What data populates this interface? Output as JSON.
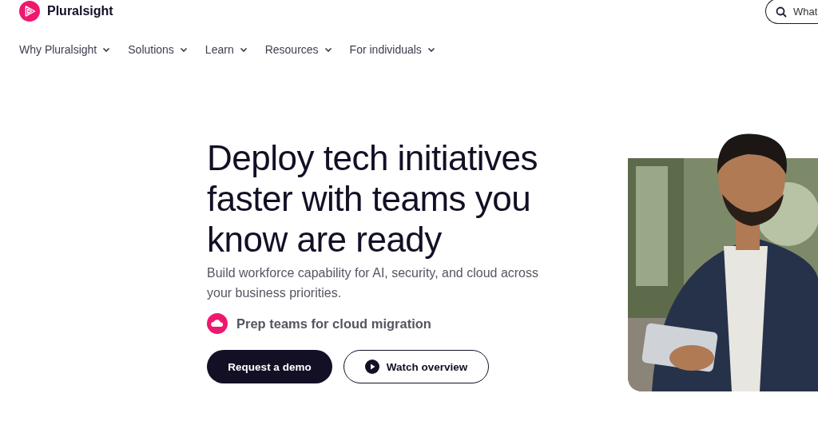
{
  "brand": {
    "name": "Pluralsight"
  },
  "search": {
    "placeholder": "What"
  },
  "nav": [
    {
      "label": "Why Pluralsight"
    },
    {
      "label": "Solutions"
    },
    {
      "label": "Learn"
    },
    {
      "label": "Resources"
    },
    {
      "label": "For individuals"
    }
  ],
  "hero": {
    "heading": "Deploy tech initiatives faster with teams you know are ready",
    "subheading": "Build workforce capability for AI, security, and cloud across your business priorities.",
    "highlight": "Prep teams for cloud migration",
    "buttons": [
      {
        "label": "Request a demo",
        "kind": "primary"
      },
      {
        "label": "Watch overview",
        "kind": "video"
      }
    ]
  }
}
